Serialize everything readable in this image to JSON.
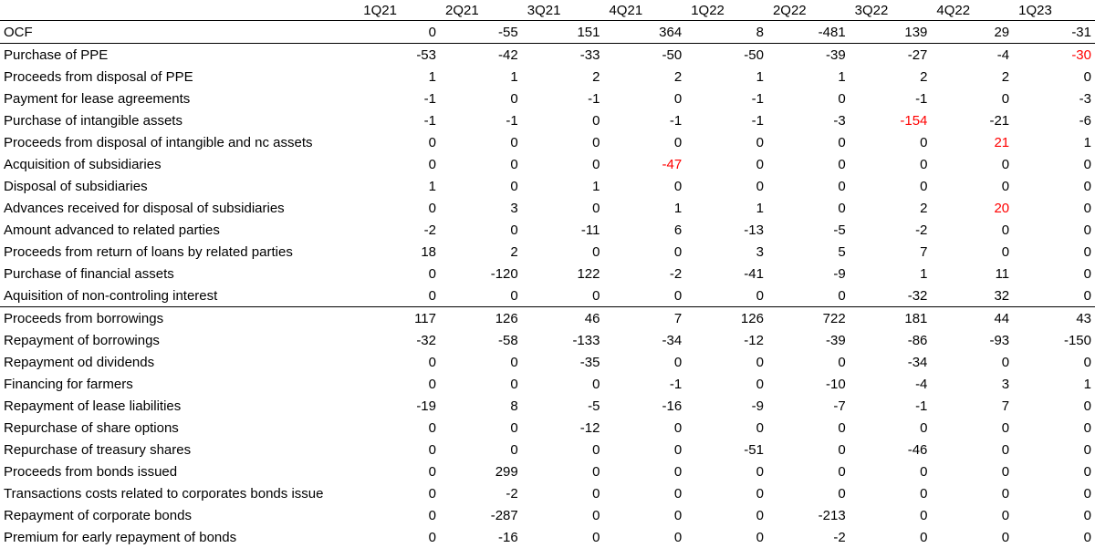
{
  "highlight_color": "#ff0000",
  "columns": [
    "1Q21",
    "2Q21",
    "3Q21",
    "4Q21",
    "1Q22",
    "2Q22",
    "3Q22",
    "4Q22",
    "1Q23"
  ],
  "rows": [
    {
      "label": "OCF",
      "values": [
        "0",
        "-55",
        "151",
        "364",
        "8",
        "-481",
        "139",
        "29",
        "-31"
      ],
      "red": [],
      "top_border": false
    },
    {
      "label": "Purchase of PPE",
      "values": [
        "-53",
        "-42",
        "-33",
        "-50",
        "-50",
        "-39",
        "-27",
        "-4",
        "-30"
      ],
      "red": [
        8
      ],
      "top_border": true
    },
    {
      "label": "Proceeds from disposal of PPE",
      "values": [
        "1",
        "1",
        "2",
        "2",
        "1",
        "1",
        "2",
        "2",
        "0"
      ],
      "red": [],
      "top_border": false
    },
    {
      "label": "Payment for lease agreements",
      "values": [
        "-1",
        "0",
        "-1",
        "0",
        "-1",
        "0",
        "-1",
        "0",
        "-3"
      ],
      "red": [],
      "top_border": false
    },
    {
      "label": "Purchase of intangible assets",
      "values": [
        "-1",
        "-1",
        "0",
        "-1",
        "-1",
        "-3",
        "-154",
        "-21",
        "-6"
      ],
      "red": [
        6
      ],
      "top_border": false
    },
    {
      "label": "Proceeds from disposal of intangible and nc assets",
      "values": [
        "0",
        "0",
        "0",
        "0",
        "0",
        "0",
        "0",
        "21",
        "1"
      ],
      "red": [
        7
      ],
      "top_border": false
    },
    {
      "label": "Acquisition of subsidiaries",
      "values": [
        "0",
        "0",
        "0",
        "-47",
        "0",
        "0",
        "0",
        "0",
        "0"
      ],
      "red": [
        3
      ],
      "top_border": false
    },
    {
      "label": "Disposal of subsidiaries",
      "values": [
        "1",
        "0",
        "1",
        "0",
        "0",
        "0",
        "0",
        "0",
        "0"
      ],
      "red": [],
      "top_border": false
    },
    {
      "label": "Advances received for disposal of subsidiaries",
      "values": [
        "0",
        "3",
        "0",
        "1",
        "1",
        "0",
        "2",
        "20",
        "0"
      ],
      "red": [
        7
      ],
      "top_border": false
    },
    {
      "label": "Amount advanced to related parties",
      "values": [
        "-2",
        "0",
        "-11",
        "6",
        "-13",
        "-5",
        "-2",
        "0",
        "0"
      ],
      "red": [],
      "top_border": false
    },
    {
      "label": "Proceeds from return of loans by related parties",
      "values": [
        "18",
        "2",
        "0",
        "0",
        "3",
        "5",
        "7",
        "0",
        "0"
      ],
      "red": [],
      "top_border": false
    },
    {
      "label": "Purchase of financial assets",
      "values": [
        "0",
        "-120",
        "122",
        "-2",
        "-41",
        "-9",
        "1",
        "11",
        "0"
      ],
      "red": [],
      "top_border": false
    },
    {
      "label": "Aquisition of non-controling interest",
      "values": [
        "0",
        "0",
        "0",
        "0",
        "0",
        "0",
        "-32",
        "32",
        "0"
      ],
      "red": [],
      "top_border": false
    },
    {
      "label": "Proceeds from borrowings",
      "values": [
        "117",
        "126",
        "46",
        "7",
        "126",
        "722",
        "181",
        "44",
        "43"
      ],
      "red": [],
      "top_border": true
    },
    {
      "label": "Repayment of borrowings",
      "values": [
        "-32",
        "-58",
        "-133",
        "-34",
        "-12",
        "-39",
        "-86",
        "-93",
        "-150"
      ],
      "red": [],
      "top_border": false
    },
    {
      "label": "Repayment od dividends",
      "values": [
        "0",
        "0",
        "-35",
        "0",
        "0",
        "0",
        "-34",
        "0",
        "0"
      ],
      "red": [],
      "top_border": false
    },
    {
      "label": "Financing for farmers",
      "values": [
        "0",
        "0",
        "0",
        "-1",
        "0",
        "-10",
        "-4",
        "3",
        "1"
      ],
      "red": [],
      "top_border": false
    },
    {
      "label": "Repayment of lease liabilities",
      "values": [
        "-19",
        "8",
        "-5",
        "-16",
        "-9",
        "-7",
        "-1",
        "7",
        "0"
      ],
      "red": [],
      "top_border": false
    },
    {
      "label": "Repurchase of share options",
      "values": [
        "0",
        "0",
        "-12",
        "0",
        "0",
        "0",
        "0",
        "0",
        "0"
      ],
      "red": [],
      "top_border": false
    },
    {
      "label": "Repurchase of treasury shares",
      "values": [
        "0",
        "0",
        "0",
        "0",
        "-51",
        "0",
        "-46",
        "0",
        "0"
      ],
      "red": [],
      "top_border": false
    },
    {
      "label": "Proceeds from bonds issued",
      "values": [
        "0",
        "299",
        "0",
        "0",
        "0",
        "0",
        "0",
        "0",
        "0"
      ],
      "red": [],
      "top_border": false
    },
    {
      "label": "Transactions costs related to corporates bonds issue",
      "values": [
        "0",
        "-2",
        "0",
        "0",
        "0",
        "0",
        "0",
        "0",
        "0"
      ],
      "red": [],
      "top_border": false
    },
    {
      "label": "Repayment of corporate bonds",
      "values": [
        "0",
        "-287",
        "0",
        "0",
        "0",
        "-213",
        "0",
        "0",
        "0"
      ],
      "red": [],
      "top_border": false
    },
    {
      "label": "Premium for early repayment of bonds",
      "values": [
        "0",
        "-16",
        "0",
        "0",
        "0",
        "-2",
        "0",
        "0",
        "0"
      ],
      "red": [],
      "top_border": false
    }
  ]
}
